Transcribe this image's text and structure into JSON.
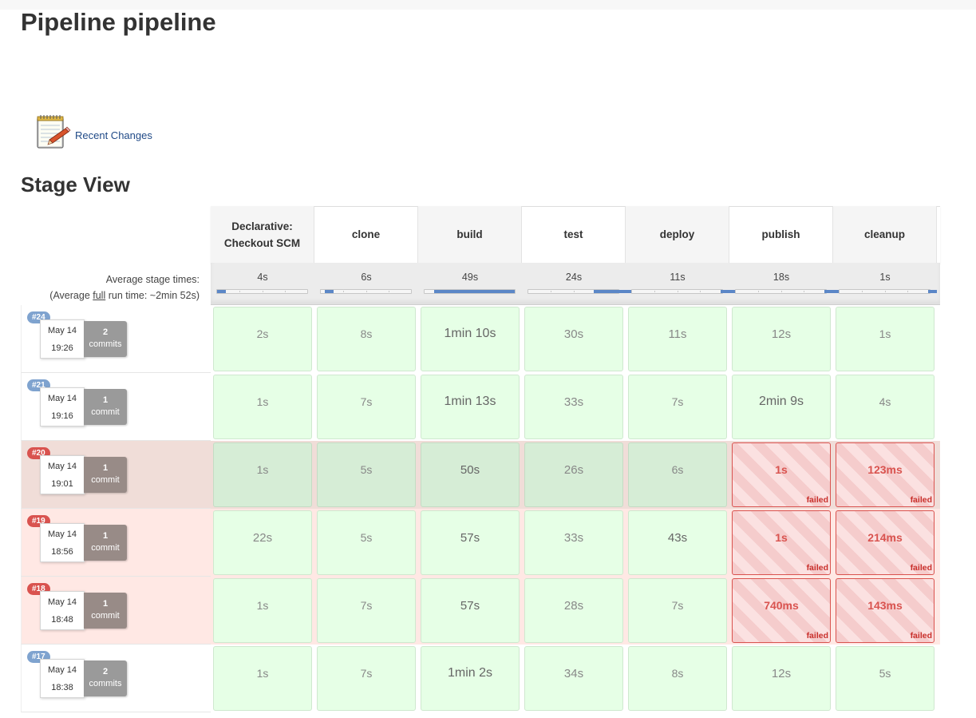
{
  "page": {
    "title": "Pipeline pipeline"
  },
  "links": {
    "recent_changes": "Recent Changes"
  },
  "stage_view": {
    "title": "Stage View",
    "avg_label": "Average stage times:",
    "avg_full_prefix": "(Average ",
    "avg_full_word": "full",
    "avg_full_suffix": " run time: ~2min 52s)",
    "stages": [
      {
        "name": "Declarative: Checkout SCM",
        "avg": "4s",
        "avg_fraction": 0.02
      },
      {
        "name": "clone",
        "avg": "6s",
        "avg_fraction": 0.03
      },
      {
        "name": "build",
        "avg": "49s",
        "avg_fraction": 0.28
      },
      {
        "name": "test",
        "avg": "24s",
        "avg_fraction": 0.14
      },
      {
        "name": "deploy",
        "avg": "11s",
        "avg_fraction": 0.06
      },
      {
        "name": "publish",
        "avg": "18s",
        "avg_fraction": 0.1
      },
      {
        "name": "cleanup",
        "avg": "1s",
        "avg_fraction": 0.01
      }
    ],
    "runs": [
      {
        "id": "#24",
        "date": "May 14",
        "time": "19:26",
        "commit_count": "2",
        "commit_word": "commits",
        "status": "success",
        "cells": [
          {
            "d": "2s",
            "s": "success"
          },
          {
            "d": "8s",
            "s": "success"
          },
          {
            "d": "1min 10s",
            "s": "success"
          },
          {
            "d": "30s",
            "s": "success"
          },
          {
            "d": "11s",
            "s": "success"
          },
          {
            "d": "12s",
            "s": "success"
          },
          {
            "d": "1s",
            "s": "success"
          }
        ]
      },
      {
        "id": "#21",
        "date": "May 14",
        "time": "19:16",
        "commit_count": "1",
        "commit_word": "commit",
        "status": "success",
        "cells": [
          {
            "d": "1s",
            "s": "success"
          },
          {
            "d": "7s",
            "s": "success"
          },
          {
            "d": "1min 13s",
            "s": "success"
          },
          {
            "d": "33s",
            "s": "success"
          },
          {
            "d": "7s",
            "s": "success"
          },
          {
            "d": "2min 9s",
            "s": "success"
          },
          {
            "d": "4s",
            "s": "success"
          }
        ]
      },
      {
        "id": "#20",
        "date": "May 14",
        "time": "19:01",
        "commit_count": "1",
        "commit_word": "commit",
        "status": "failed",
        "selected": true,
        "cells": [
          {
            "d": "1s",
            "s": "success"
          },
          {
            "d": "5s",
            "s": "success"
          },
          {
            "d": "50s",
            "s": "success"
          },
          {
            "d": "26s",
            "s": "success"
          },
          {
            "d": "6s",
            "s": "success"
          },
          {
            "d": "1s",
            "s": "failed"
          },
          {
            "d": "123ms",
            "s": "failed"
          }
        ]
      },
      {
        "id": "#19",
        "date": "May 14",
        "time": "18:56",
        "commit_count": "1",
        "commit_word": "commit",
        "status": "failed",
        "cells": [
          {
            "d": "22s",
            "s": "success"
          },
          {
            "d": "5s",
            "s": "success"
          },
          {
            "d": "57s",
            "s": "success"
          },
          {
            "d": "33s",
            "s": "success"
          },
          {
            "d": "43s",
            "s": "success"
          },
          {
            "d": "1s",
            "s": "failed"
          },
          {
            "d": "214ms",
            "s": "failed"
          }
        ]
      },
      {
        "id": "#18",
        "date": "May 14",
        "time": "18:48",
        "commit_count": "1",
        "commit_word": "commit",
        "status": "failed",
        "cells": [
          {
            "d": "1s",
            "s": "success"
          },
          {
            "d": "7s",
            "s": "success"
          },
          {
            "d": "57s",
            "s": "success"
          },
          {
            "d": "28s",
            "s": "success"
          },
          {
            "d": "7s",
            "s": "success"
          },
          {
            "d": "740ms",
            "s": "failed"
          },
          {
            "d": "143ms",
            "s": "failed"
          }
        ]
      },
      {
        "id": "#17",
        "date": "May 14",
        "time": "18:38",
        "commit_count": "2",
        "commit_word": "commits",
        "status": "success",
        "cells": [
          {
            "d": "1s",
            "s": "success"
          },
          {
            "d": "7s",
            "s": "success"
          },
          {
            "d": "1min 2s",
            "s": "success"
          },
          {
            "d": "34s",
            "s": "success"
          },
          {
            "d": "8s",
            "s": "success"
          },
          {
            "d": "12s",
            "s": "success"
          },
          {
            "d": "5s",
            "s": "success"
          }
        ]
      }
    ],
    "failed_label": "failed"
  },
  "colors": {
    "badge_success": "#7fa3cf",
    "badge_failed": "#d9534f",
    "row_failed_bg": "#ffe8e4",
    "row_selected_bg": "#f0ddd8",
    "commit_grey": "#9a9a9a",
    "commit_dark": "#988b87",
    "link": "#204a87",
    "cell_success": "#e6ffe6",
    "cell_failed_border": "#d9534f"
  },
  "icons": {
    "recent_changes": "notepad-icon"
  }
}
